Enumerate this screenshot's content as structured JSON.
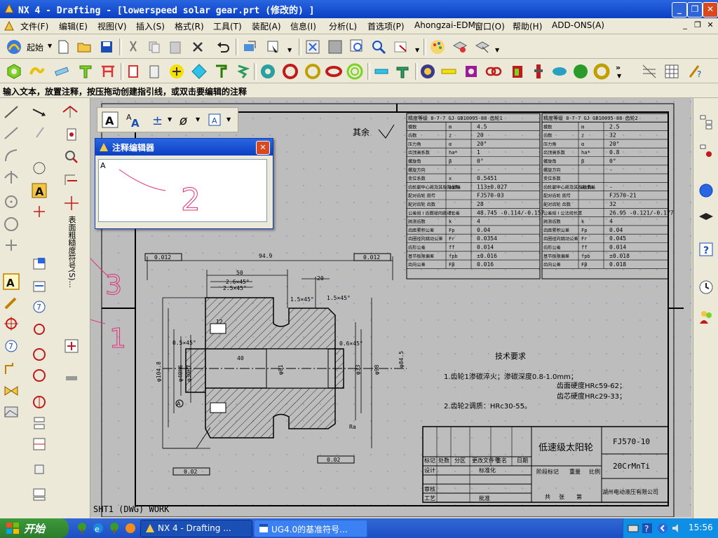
{
  "window": {
    "title": "NX 4 - Drafting - [lowerspeed solar gear.prt (修改的) ]"
  },
  "menu": [
    "文件(F)",
    "编辑(E)",
    "视图(V)",
    "插入(S)",
    "格式(R)",
    "工具(T)",
    "装配(A)",
    "信息(I)",
    "分析(L)",
    "首选项(P)",
    "Ahongzai-EDM",
    "窗口(O)",
    "帮助(H)",
    "ADD-ONS(A)"
  ],
  "toolbar": {
    "start_label": "起始"
  },
  "cue_line": "输入文本，放置注释，按压拖动创建指引线，或双击要编辑的注释",
  "note_editor": {
    "title": "注释编辑器",
    "text": "A"
  },
  "left_palette_vertical_label": "表面粗糙度符号(S)...",
  "handwriting": [
    "3",
    "1",
    "2"
  ],
  "drawing": {
    "sheet_label": "SHT1 (DWG) WORK",
    "qiyu": "其余",
    "gear_table_left": {
      "header": "精度等级 8-7-7 GJ GB10095-88 齿轮1",
      "rows": [
        [
          "模数",
          "m",
          "4.5"
        ],
        [
          "齿数",
          "z",
          "20"
        ],
        [
          "压力角",
          "α",
          "20°"
        ],
        [
          "齿顶高系数",
          "ha*",
          "1"
        ],
        [
          "螺旋角",
          "β",
          "0°"
        ],
        [
          "螺旋方向",
          "",
          "-"
        ],
        [
          "变位系数",
          "x",
          "0.5451"
        ],
        [
          "齿轮副中心距及其极限偏差",
          "a±fa",
          "113±0.027"
        ],
        [
          "配对齿轮 图号",
          "",
          "FJ570-03"
        ],
        [
          "配对齿轮 齿数",
          "",
          "28"
        ],
        [
          "公差组 I 齿圈径向跳动公差",
          "Fr",
          "48.745 -0.114/-0.157"
        ],
        [
          "跨测齿数",
          "k",
          "4"
        ],
        [
          "齿距累积公差",
          "Fp",
          "0.04"
        ],
        [
          "齿圈径向跳动公差",
          "Fr",
          "0.0354"
        ],
        [
          "齿形公差",
          "ff",
          "0.014"
        ],
        [
          "基节极限偏差",
          "fpb",
          "±0.016"
        ],
        [
          "齿向公差",
          "Fβ",
          "0.016"
        ]
      ]
    },
    "gear_table_right": {
      "header": "精度等级 8-7-7 GJ GB10095-88 齿轮2",
      "rows": [
        [
          "模数",
          "m",
          "2.5"
        ],
        [
          "齿数",
          "z",
          "32"
        ],
        [
          "压力角",
          "α",
          "20°"
        ],
        [
          "齿顶高系数",
          "ha*",
          "0.8"
        ],
        [
          "螺旋角",
          "β",
          "0°"
        ],
        [
          "螺旋方向",
          "",
          "-"
        ],
        [
          "变位系数",
          "",
          ""
        ],
        [
          "齿轮副中心距及其极限偏差",
          "a±fa",
          "-"
        ],
        [
          "配对齿轮 图号",
          "",
          "FJ570-21"
        ],
        [
          "配对齿轮 齿数",
          "",
          "32"
        ],
        [
          "公差组 I 公法线长度",
          "",
          "26.95 -0.121/-0.177"
        ],
        [
          "跨测齿数",
          "k",
          "4"
        ],
        [
          "齿距累积公差",
          "Fp",
          "0.04"
        ],
        [
          "齿圈径向跳动公差",
          "Fr",
          "0.045"
        ],
        [
          "齿形公差",
          "ff",
          "0.014"
        ],
        [
          "基节极限偏差",
          "fpb",
          "±0.018"
        ],
        [
          "齿向公差",
          "Fβ",
          "0.018"
        ]
      ]
    },
    "tech_title": "技术要求",
    "tech_lines": [
      "1.齿轮1渗碳淬火；渗碳深度0.8-1.0mm；",
      "齿面硬度HRc59-62；",
      "齿芯硬度HRc29-33；",
      "2.齿轮2调质：HRc30-55。"
    ],
    "dims": {
      "d94": "94.9",
      "d50": "50",
      "d26": "2.6×45°",
      "d25": "2.5×45°",
      "d15a": "1.5×45°",
      "d15b": "1.5×45°",
      "d20": "20",
      "d40": "40",
      "d05": "0.5×45°",
      "d06": "0.6×45°",
      "phi104": "φ104.8",
      "phi30": "φ30H7",
      "phi40": "φ40h6",
      "phi81": "φ81",
      "phi33": "φ33",
      "phi98": "φ98",
      "phi84": "φ84.5",
      "d12": "12",
      "tol1": "0.012",
      "tol2": "0.012",
      "tol3": "0.02",
      "tol4": "0.02",
      "ra": "Ra"
    },
    "title_block": {
      "part_name": "低速级太阳轮",
      "drawing_no": "FJ570-10",
      "material": "20CrMnTi",
      "company": "湖州电动液压有限公司",
      "labels": [
        "标记",
        "处数",
        "分区",
        "更改文件号",
        "签名",
        "日期",
        "设计",
        "标准化",
        "审核",
        "工艺",
        "批准",
        "阶段标记",
        "重量",
        "比例",
        "共",
        "张",
        "第"
      ]
    }
  },
  "taskbar": {
    "start": "开始",
    "tasks": [
      "NX 4 - Drafting ...",
      "UG4.0的基准符号..."
    ],
    "clock": "15:56"
  },
  "colors": {
    "accent": "#0a3fc4",
    "canvas": "#bdbdbd",
    "handwriting": "#e0307a"
  }
}
